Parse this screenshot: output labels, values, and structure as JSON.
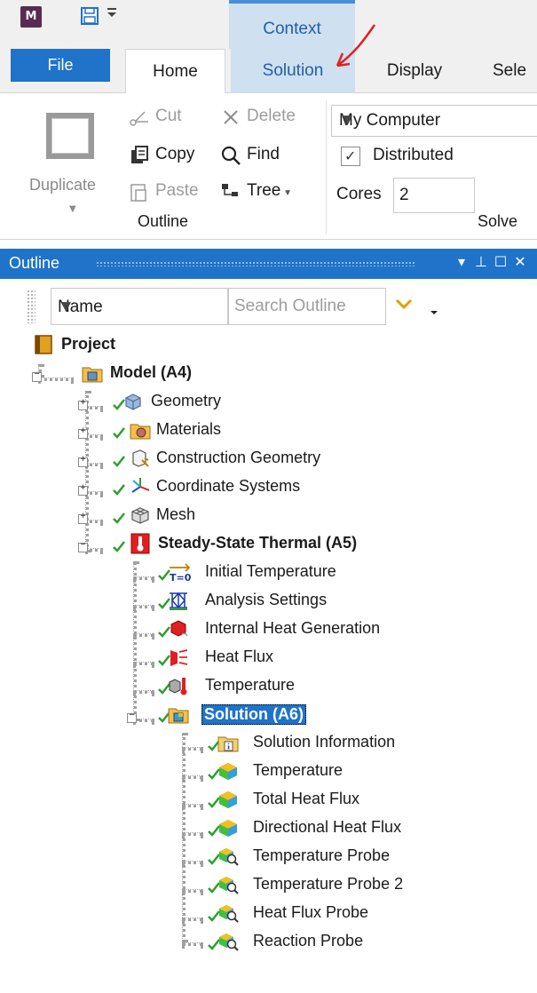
{
  "title_bar": {
    "app_logo_letter": "M",
    "context_header": "Context"
  },
  "tabs": {
    "file": "File",
    "home": "Home",
    "solution": "Solution",
    "display": "Display",
    "select": "Sele"
  },
  "ribbon": {
    "duplicate": "Duplicate",
    "cut": "Cut",
    "delete": "Delete",
    "copy": "Copy",
    "find": "Find",
    "paste": "Paste",
    "tree": "Tree",
    "outline_group": "Outline",
    "solver_location": "My Computer",
    "distributed_label": "Distributed",
    "distributed_checked": true,
    "cores_label": "Cores",
    "cores_value": "2",
    "solve_group": "Solve"
  },
  "outline": {
    "title": "Outline",
    "name_filter": "Name",
    "search_placeholder": "Search Outline",
    "tree": {
      "project": "Project",
      "model": "Model (A4)",
      "geometry": "Geometry",
      "materials": "Materials",
      "construction_geometry": "Construction Geometry",
      "coordinate_systems": "Coordinate Systems",
      "mesh": "Mesh",
      "steady_state_thermal": "Steady-State Thermal (A5)",
      "initial_temperature": "Initial Temperature",
      "analysis_settings": "Analysis Settings",
      "internal_heat_generation": "Internal Heat Generation",
      "heat_flux": "Heat Flux",
      "temperature_bc": "Temperature",
      "solution": "Solution (A6)",
      "solution_information": "Solution Information",
      "temperature_result": "Temperature",
      "total_heat_flux": "Total Heat Flux",
      "directional_heat_flux": "Directional Heat Flux",
      "temperature_probe": "Temperature Probe",
      "temperature_probe_2": "Temperature Probe 2",
      "heat_flux_probe": "Heat Flux Probe",
      "reaction_probe": "Reaction Probe"
    },
    "initial_temperature_icon_text": "T=0"
  },
  "colors": {
    "accent": "#1f73c9",
    "context_tab": "#cfe0f1",
    "check_green": "#2e9e2e",
    "annotation_red": "#e02020"
  }
}
